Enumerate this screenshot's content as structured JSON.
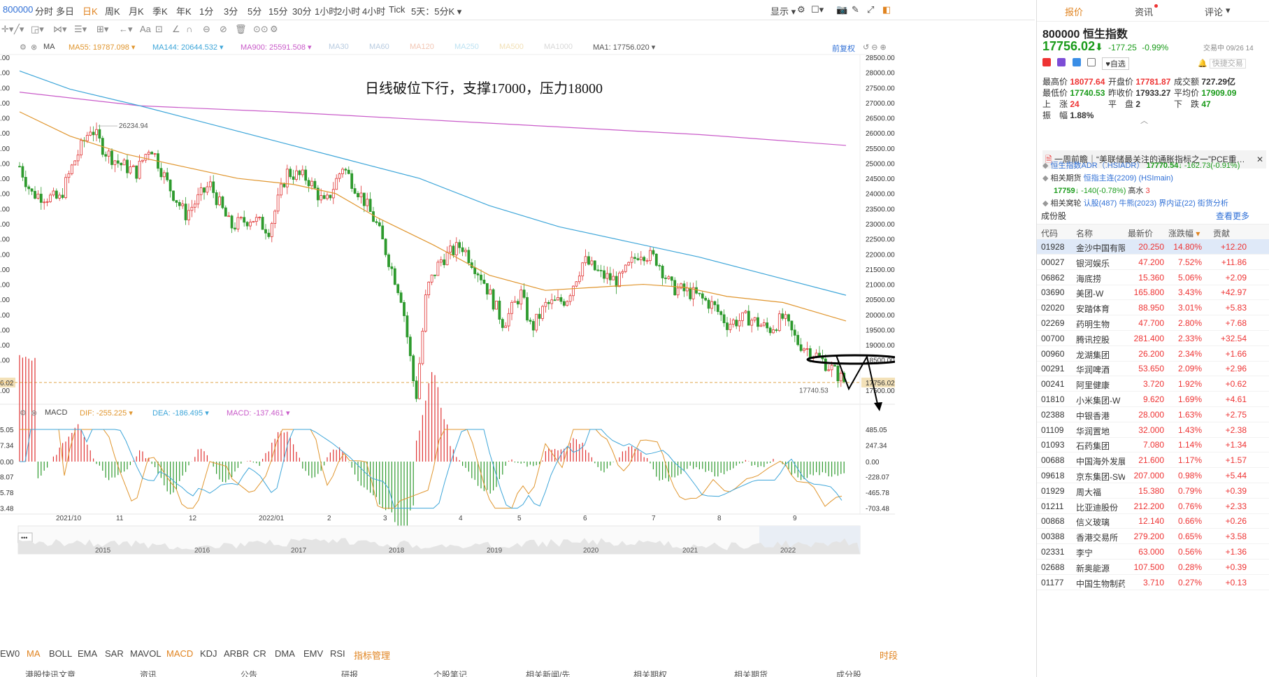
{
  "topbar": {
    "symbol": "800000",
    "tabs": [
      "分时",
      "多日",
      "日K",
      "周K",
      "月K",
      "季K",
      "年K",
      "1分",
      "3分",
      "5分",
      "15分",
      "30分",
      "1小时",
      "2小时",
      "4小时",
      "Tick",
      "5天：5分K"
    ],
    "active_tab": "日K",
    "display_label": "显示"
  },
  "ma_row": {
    "ma_label": "MA",
    "items": [
      {
        "text": "MA55: 19787.098",
        "color": "#e0962f"
      },
      {
        "text": "MA144: 20644.532",
        "color": "#3ea6d9"
      },
      {
        "text": "MA900: 25591.508",
        "color": "#c95bc9"
      },
      {
        "text": "MA30",
        "color": "#b8cbe0"
      },
      {
        "text": "MA60",
        "color": "#b8cbe0"
      },
      {
        "text": "MA120",
        "color": "#f2c6b4"
      },
      {
        "text": "MA250",
        "color": "#bde2f2"
      },
      {
        "text": "MA500",
        "color": "#f2e0b6"
      },
      {
        "text": "MA1000",
        "color": "#d8d8d8"
      },
      {
        "text": "MA1: 17756.020",
        "color": "#555555"
      }
    ],
    "adjust_label": "前复权"
  },
  "annotation_text": "日线破位下行，支撑17000，压力18000",
  "high_label": "26234.94",
  "low_label": "17740.53",
  "price_axis": {
    "right_ticks": [
      "28500.00",
      "28000.00",
      "27500.00",
      "27000.00",
      "26500.00",
      "26000.00",
      "25500.00",
      "25000.00",
      "24500.00",
      "24000.00",
      "23500.00",
      "23000.00",
      "22500.00",
      "22000.00",
      "21500.00",
      "21000.00",
      "20500.00",
      "20000.00",
      "19500.00",
      "19000.00",
      "18500.00",
      "17756.02",
      "17500.00"
    ],
    "left_ticks": [
      ".00",
      ".00",
      ".00",
      ".00",
      ".00",
      ".00",
      ".00",
      ".00",
      ".00",
      ".00",
      ".00",
      ".00",
      ".00",
      ".00",
      ".00",
      ".00",
      ".00",
      ".00",
      ".00",
      ".00",
      ".00",
      "6.02",
      ".00"
    ],
    "current_price": "17756.02"
  },
  "macd_row": {
    "label": "MACD",
    "dif": "DIF: -255.225",
    "dea": "DEA: -186.495",
    "macd": "MACD: -137.461",
    "right_ticks": [
      "485.05",
      "247.34",
      "0.00",
      "-228.07",
      "-465.78",
      "-703.48"
    ],
    "left_ticks": [
      "5.05",
      "7.34",
      "0.00",
      "8.07",
      "5.78",
      "3.48"
    ]
  },
  "time_axis": [
    "2021/10",
    "11",
    "12",
    "2022/01",
    "2",
    "3",
    "4",
    "5",
    "6",
    "7",
    "8",
    "9"
  ],
  "overview_years": [
    "2015",
    "2016",
    "2017",
    "2018",
    "2019",
    "2020",
    "2021",
    "2022"
  ],
  "indicators": [
    "EW0",
    "MA",
    "BOLL",
    "EMA",
    "SAR",
    "MAVOL",
    "MACD",
    "KDJ",
    "ARBR",
    "CR",
    "DMA",
    "EMV",
    "RSI",
    "指标管理"
  ],
  "indicators_active": [
    "MA",
    "MACD",
    "指标管理"
  ],
  "timing_label": "时段",
  "bottom_tabs": [
    "港股快讯文章",
    "资讯",
    "公告",
    "研报",
    "个股笔记",
    "相关新闻/先",
    "相关期权",
    "相关期货",
    "成分股"
  ],
  "right": {
    "tabs": [
      "报价",
      "资讯",
      "评论"
    ],
    "code": "800000",
    "name": "恒生指数",
    "price": "17756.02",
    "arrow": "⬇",
    "change": "-177.25",
    "change_pct": "-0.99%",
    "trade_status": "交易中 09/26 14",
    "watch_label": "自选",
    "quick_label": "快捷交易",
    "stats": [
      {
        "k": "最高价",
        "v": "18077.64",
        "c": "red"
      },
      {
        "k": "开盘价",
        "v": "17781.87",
        "c": "red"
      },
      {
        "k": "成交额",
        "v": "727.29亿",
        "c": "dark"
      },
      {
        "k": "最低价",
        "v": "17740.53",
        "c": "green"
      },
      {
        "k": "昨收价",
        "v": "17933.27",
        "c": "dark"
      },
      {
        "k": "平均价",
        "v": "17909.09",
        "c": "green"
      },
      {
        "k": "上　涨",
        "v": "24",
        "c": "red"
      },
      {
        "k": "平　盘",
        "v": "2",
        "c": "dark"
      },
      {
        "k": "下　跌",
        "v": "47",
        "c": "green"
      },
      {
        "k": "振　幅",
        "v": "1.88%",
        "c": "dark"
      }
    ],
    "news": "一周前瞻｜“美联储最关注的通胀指标之一”PCE重…",
    "related": {
      "adr_label": "恒生指数ADR（.HSIADR）",
      "adr_value": "17770.54↓",
      "adr_change": "-162.73(-0.91%)",
      "fut_label": "相关期货",
      "fut_name": "恒指主连(2209)",
      "fut_code": "(HSImain)",
      "fut_value": "17759↓",
      "fut_change": "-140(-0.78%)",
      "fut_extra": "高水",
      "fut_extra_val": "3",
      "war_label": "相关窝轮",
      "war_items": [
        "认股(487)",
        "牛熊(2023)",
        "界内证(22)",
        "街货分析"
      ]
    },
    "constituents_title": "成份股",
    "constituents_more": "查看更多",
    "columns": [
      "代码",
      "名称",
      "最新价",
      "涨跌幅",
      "贡献"
    ],
    "rows": [
      [
        "01928",
        "金沙中国有限",
        "20.250",
        "14.80%",
        "+12.20"
      ],
      [
        "00027",
        "银河娱乐",
        "47.200",
        "7.52%",
        "+11.86"
      ],
      [
        "06862",
        "海底捞",
        "15.360",
        "5.06%",
        "+2.09"
      ],
      [
        "03690",
        "美团-W",
        "165.800",
        "3.43%",
        "+42.97"
      ],
      [
        "02020",
        "安踏体育",
        "88.950",
        "3.01%",
        "+5.83"
      ],
      [
        "02269",
        "药明生物",
        "47.700",
        "2.80%",
        "+7.68"
      ],
      [
        "00700",
        "腾讯控股",
        "281.400",
        "2.33%",
        "+32.54"
      ],
      [
        "00960",
        "龙湖集团",
        "26.200",
        "2.34%",
        "+1.66"
      ],
      [
        "00291",
        "华润啤酒",
        "53.650",
        "2.09%",
        "+2.96"
      ],
      [
        "00241",
        "阿里健康",
        "3.720",
        "1.92%",
        "+0.62"
      ],
      [
        "01810",
        "小米集团-W",
        "9.620",
        "1.69%",
        "+4.61"
      ],
      [
        "02388",
        "中银香港",
        "28.000",
        "1.63%",
        "+2.75"
      ],
      [
        "01109",
        "华润置地",
        "32.000",
        "1.43%",
        "+2.38"
      ],
      [
        "01093",
        "石药集团",
        "7.080",
        "1.14%",
        "+1.34"
      ],
      [
        "00688",
        "中国海外发展",
        "21.600",
        "1.17%",
        "+1.57"
      ],
      [
        "09618",
        "京东集团-SW",
        "207.000",
        "0.98%",
        "+5.44"
      ],
      [
        "01929",
        "周大福",
        "15.380",
        "0.79%",
        "+0.39"
      ],
      [
        "01211",
        "比亚迪股份",
        "212.200",
        "0.76%",
        "+2.33"
      ],
      [
        "00868",
        "信义玻璃",
        "12.140",
        "0.66%",
        "+0.26"
      ],
      [
        "00388",
        "香港交易所",
        "279.200",
        "0.65%",
        "+3.58"
      ],
      [
        "02331",
        "李宁",
        "63.000",
        "0.56%",
        "+1.36"
      ],
      [
        "02688",
        "新奥能源",
        "107.500",
        "0.28%",
        "+0.39"
      ],
      [
        "01177",
        "中国生物制药",
        "3.710",
        "0.27%",
        "+0.13"
      ]
    ]
  }
}
